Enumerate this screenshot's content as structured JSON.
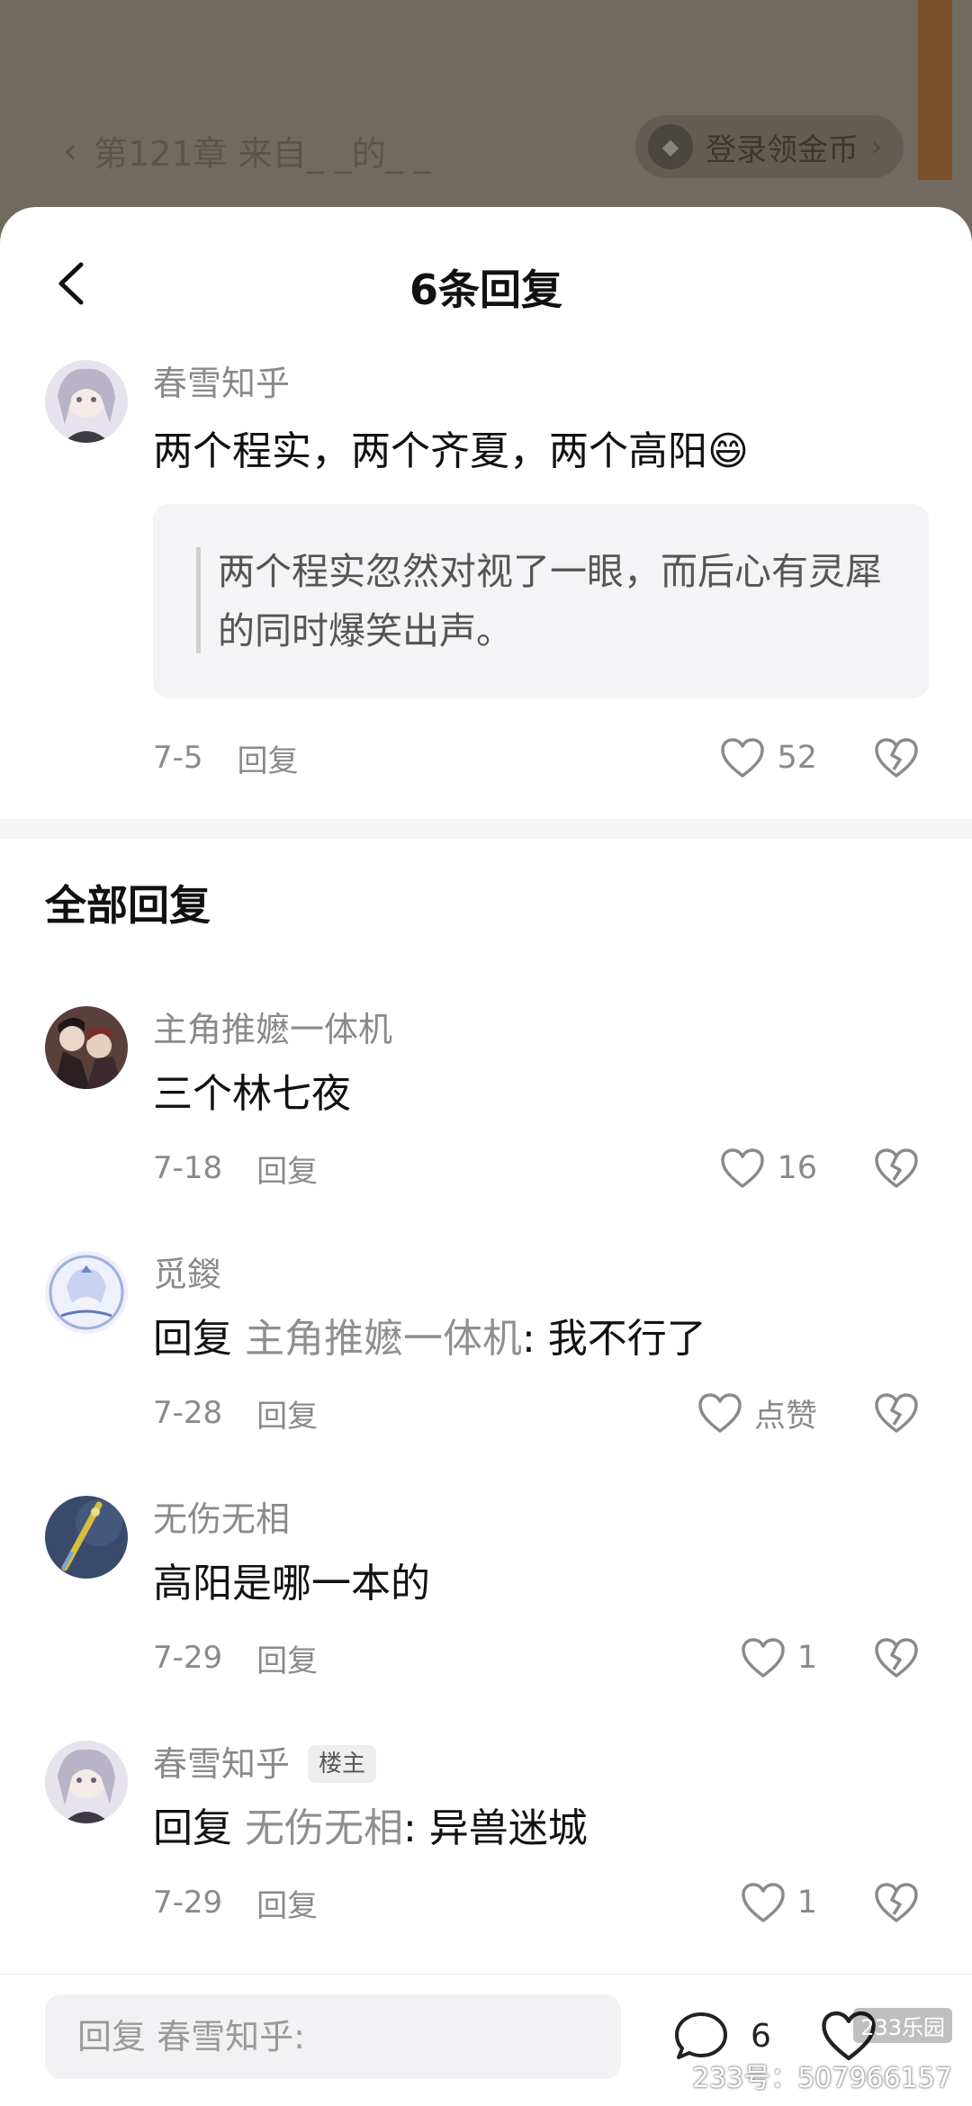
{
  "reader": {
    "chapter_title": "第121章 来自_ _的_ _",
    "coin_button": "登录领金币"
  },
  "sheet": {
    "title": "6条回复"
  },
  "main_comment": {
    "user": "春雪知乎",
    "text": "两个程实，两个齐夏，两个高阳",
    "emoji": "😄",
    "quote": "两个程实忽然对视了一眼，而后心有灵犀的同时爆笑出声。",
    "date": "7-5",
    "reply_label": "回复",
    "likes": "52"
  },
  "replies_section": {
    "title": "全部回复"
  },
  "replies": [
    {
      "user": "主角推嬷一体机",
      "prefix": "",
      "mention": "",
      "text": "三个林七夜",
      "date": "7-18",
      "reply_label": "回复",
      "likes": "16",
      "tag": ""
    },
    {
      "user": "觅鍐",
      "prefix": "回复 ",
      "mention": "主角推嬷一体机",
      "text": ": 我不行了",
      "date": "7-28",
      "reply_label": "回复",
      "likes": "点赞",
      "tag": ""
    },
    {
      "user": "无伤无相",
      "prefix": "",
      "mention": "",
      "text": "高阳是哪一本的",
      "date": "7-29",
      "reply_label": "回复",
      "likes": "1",
      "tag": ""
    },
    {
      "user": "春雪知乎",
      "prefix": "回复 ",
      "mention": "无伤无相",
      "text": ": 异兽迷城",
      "date": "7-29",
      "reply_label": "回复",
      "likes": "1",
      "tag": "楼主"
    }
  ],
  "bottom_bar": {
    "input_placeholder": "回复 春雪知乎:",
    "comment_count": "6"
  },
  "watermark": {
    "line1": "233乐园",
    "line2": "233号：507966157"
  }
}
